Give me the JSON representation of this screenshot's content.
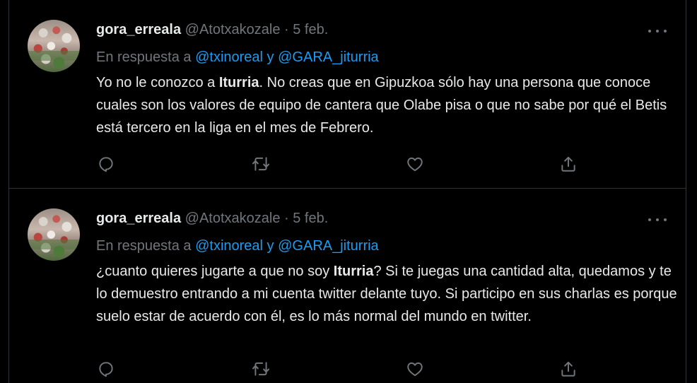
{
  "tweets": [
    {
      "display_name": "gora_erreala",
      "handle": "@Atotxakozale",
      "separator": " · ",
      "date": "5 feb.",
      "reply_prefix": "En respuesta a ",
      "mention_1": "@txinoreal",
      "reply_and": " y ",
      "mention_2": "@GARA_jiturria",
      "text_part_1": "Yo no le conozco a ",
      "text_bold": "Iturria",
      "text_part_2": ". No creas que en Gipuzkoa sólo hay una persona que conoce cuales son los valores de equipo de cantera que Olabe pisa o que no sabe por qué el Betis está tercero en la liga en el mes de Febrero."
    },
    {
      "display_name": "gora_erreala",
      "handle": "@Atotxakozale",
      "separator": " · ",
      "date": "5 feb.",
      "reply_prefix": "En respuesta a ",
      "mention_1": "@txinoreal",
      "reply_and": " y ",
      "mention_2": "@GARA_jiturria",
      "text_part_1": "¿cuanto quieres jugarte a que no soy ",
      "text_bold": "Iturria",
      "text_part_2": "? Si te juegas una cantidad alta, quedamos y te lo demuestro entrando a mi cuenta twitter delante tuyo. Si participo en sus charlas es porque suelo estar de acuerdo con él, es lo más normal del mundo en twitter."
    }
  ],
  "icons": {
    "reply": "reply-icon",
    "retweet": "retweet-icon",
    "like": "like-icon",
    "share": "share-icon",
    "more": "more-icon"
  },
  "colors": {
    "background": "#000000",
    "text": "#e7e9ea",
    "secondary": "#71767b",
    "link": "#1d9bf0",
    "border": "#2f3336"
  }
}
